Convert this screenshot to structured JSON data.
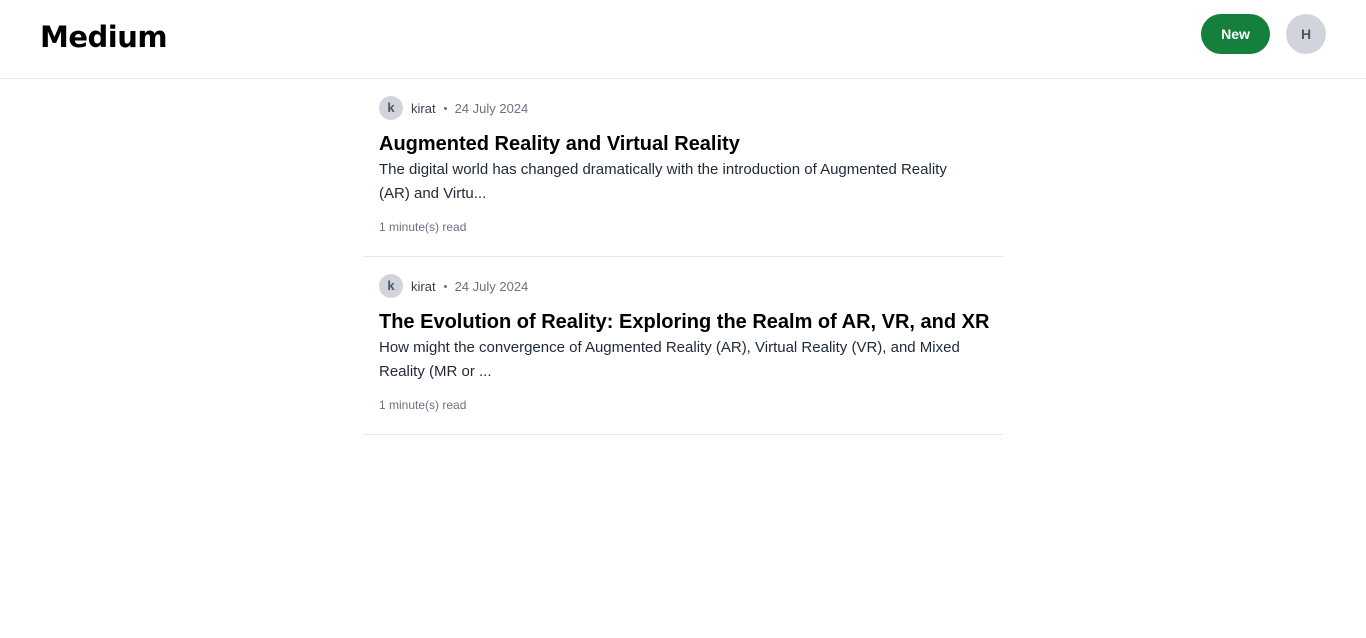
{
  "header": {
    "logo": "Medium",
    "new_button_label": "New",
    "user_avatar_initial": "H"
  },
  "posts": [
    {
      "author_initial": "k",
      "author_name": "kirat",
      "date": "24 July 2024",
      "title": "Augmented Reality and Virtual Reality",
      "excerpt": "The digital world has changed dramatically with the introduction of Augmented Reality (AR) and Virtu...",
      "read_time": "1 minute(s) read"
    },
    {
      "author_initial": "k",
      "author_name": "kirat",
      "date": "24 July 2024",
      "title": "The Evolution of Reality: Exploring the Realm of AR, VR, and XR",
      "excerpt": "How might the convergence of Augmented Reality (AR), Virtual Reality (VR), and Mixed Reality (MR or ...",
      "read_time": "1 minute(s) read"
    }
  ],
  "colors": {
    "accent": "#15803d",
    "avatar_bg": "#d1d5db",
    "divider": "#e5e7eb"
  }
}
